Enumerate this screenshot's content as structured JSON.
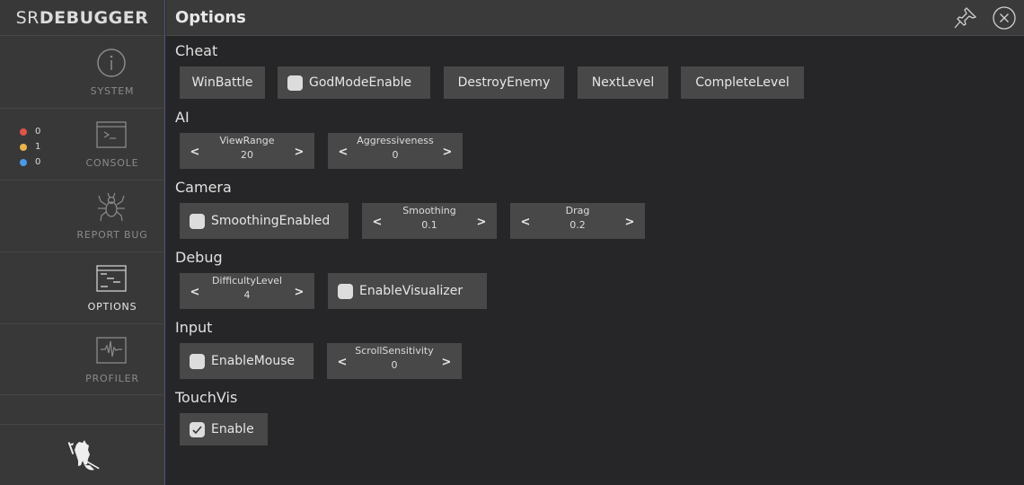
{
  "sidebar": {
    "logo_prefix": "SR",
    "logo_main": "DEBUGGER",
    "items": [
      {
        "label": "SYSTEM",
        "icon": "info-icon"
      },
      {
        "label": "CONSOLE",
        "icon": "console-icon"
      },
      {
        "label": "REPORT BUG",
        "icon": "bug-icon"
      },
      {
        "label": "OPTIONS",
        "icon": "options-icon",
        "active": true
      },
      {
        "label": "PROFILER",
        "icon": "profiler-icon"
      }
    ],
    "console_counts": [
      {
        "type": "error",
        "color": "#e0544a",
        "count": "0"
      },
      {
        "type": "warning",
        "color": "#e8b44a",
        "count": "1"
      },
      {
        "type": "info",
        "color": "#4a9ae8",
        "count": "0"
      }
    ]
  },
  "header": {
    "title": "Options",
    "pin_icon": "pin-icon",
    "close_icon": "close-icon"
  },
  "categories": [
    {
      "title": "Cheat",
      "controls": [
        {
          "type": "button",
          "label": "WinBattle"
        },
        {
          "type": "toggle",
          "label": "GodModeEnable",
          "checked": false
        },
        {
          "type": "button",
          "label": "DestroyEnemy"
        },
        {
          "type": "button",
          "label": "NextLevel"
        },
        {
          "type": "button",
          "label": "CompleteLevel"
        }
      ]
    },
    {
      "title": "AI",
      "controls": [
        {
          "type": "number",
          "label": "ViewRange",
          "value": "20"
        },
        {
          "type": "number",
          "label": "Aggressiveness",
          "value": "0"
        }
      ]
    },
    {
      "title": "Camera",
      "controls": [
        {
          "type": "toggle",
          "label": "SmoothingEnabled",
          "checked": false
        },
        {
          "type": "number",
          "label": "Smoothing",
          "value": "0.1"
        },
        {
          "type": "number",
          "label": "Drag",
          "value": "0.2"
        }
      ]
    },
    {
      "title": "Debug",
      "controls": [
        {
          "type": "number",
          "label": "DifficultyLevel",
          "value": "4"
        },
        {
          "type": "toggle",
          "label": "EnableVisualizer",
          "checked": false
        }
      ]
    },
    {
      "title": "Input",
      "controls": [
        {
          "type": "toggle",
          "label": "EnableMouse",
          "checked": false
        },
        {
          "type": "number",
          "label": "ScrollSensitivity",
          "value": "0"
        }
      ]
    },
    {
      "title": "TouchVis",
      "controls": [
        {
          "type": "toggle",
          "label": "Enable",
          "checked": true
        }
      ]
    }
  ],
  "arrows": {
    "decrement": "<",
    "increment": ">"
  }
}
